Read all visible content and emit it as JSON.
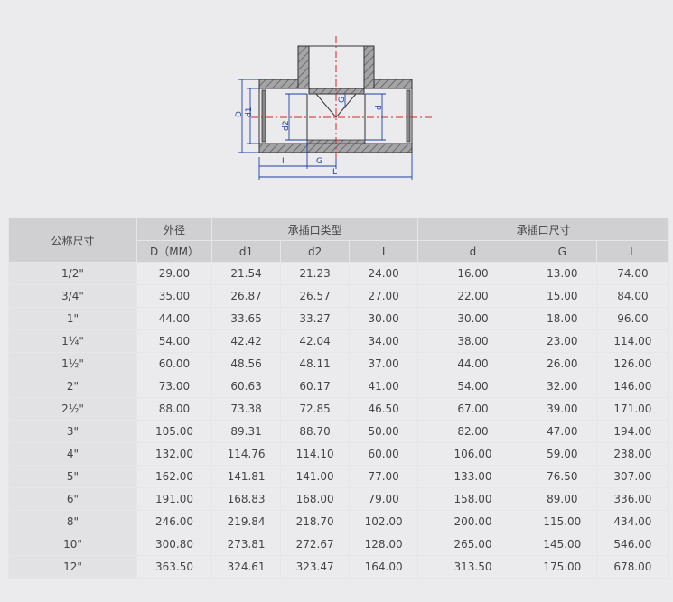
{
  "diagram": {
    "labels": {
      "D": "D",
      "d1": "d1",
      "d2": "d2",
      "G_vertical": "G",
      "d": "d",
      "I": "I",
      "G": "G",
      "L": "L"
    },
    "colors": {
      "body": "#9a9a9d",
      "hatch": "#5a5a5e",
      "outline": "#333333",
      "dim": "#1f3f9f",
      "center": "#d8252a"
    }
  },
  "table": {
    "header_nominal": "公称尺寸",
    "header_outer": "外径",
    "header_socket_type": "承插口类型",
    "header_socket_size": "承插口尺寸",
    "sub_headers": [
      "D（MM）",
      "d1",
      "d2",
      "I",
      "d",
      "G",
      "L"
    ],
    "rows": [
      [
        "1/2\"",
        "29.00",
        "21.54",
        "21.23",
        "24.00",
        "16.00",
        "13.00",
        "74.00"
      ],
      [
        "3/4\"",
        "35.00",
        "26.87",
        "26.57",
        "27.00",
        "22.00",
        "15.00",
        "84.00"
      ],
      [
        "1\"",
        "44.00",
        "33.65",
        "33.27",
        "30.00",
        "30.00",
        "18.00",
        "96.00"
      ],
      [
        "1¼\"",
        "54.00",
        "42.42",
        "42.04",
        "34.00",
        "38.00",
        "23.00",
        "114.00"
      ],
      [
        "1½\"",
        "60.00",
        "48.56",
        "48.11",
        "37.00",
        "44.00",
        "26.00",
        "126.00"
      ],
      [
        "2\"",
        "73.00",
        "60.63",
        "60.17",
        "41.00",
        "54.00",
        "32.00",
        "146.00"
      ],
      [
        "2½\"",
        "88.00",
        "73.38",
        "72.85",
        "46.50",
        "67.00",
        "39.00",
        "171.00"
      ],
      [
        "3\"",
        "105.00",
        "89.31",
        "88.70",
        "50.00",
        "82.00",
        "47.00",
        "194.00"
      ],
      [
        "4\"",
        "132.00",
        "114.76",
        "114.10",
        "60.00",
        "106.00",
        "59.00",
        "238.00"
      ],
      [
        "5\"",
        "162.00",
        "141.81",
        "141.00",
        "77.00",
        "133.00",
        "76.50",
        "307.00"
      ],
      [
        "6\"",
        "191.00",
        "168.83",
        "168.00",
        "79.00",
        "158.00",
        "89.00",
        "336.00"
      ],
      [
        "8\"",
        "246.00",
        "219.84",
        "218.70",
        "102.00",
        "200.00",
        "115.00",
        "434.00"
      ],
      [
        "10\"",
        "300.80",
        "273.81",
        "272.67",
        "128.00",
        "265.00",
        "145.00",
        "546.00"
      ],
      [
        "12\"",
        "363.50",
        "324.61",
        "323.47",
        "164.00",
        "313.50",
        "175.00",
        "678.00"
      ]
    ]
  }
}
